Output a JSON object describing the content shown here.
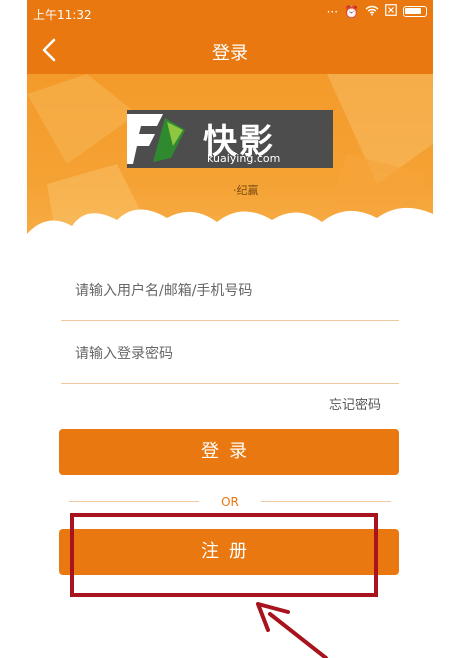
{
  "status_bar": {
    "time": "上午11:32",
    "icons": [
      "signal-dots-icon",
      "alarm-icon",
      "wifi-icon",
      "close-box-icon",
      "battery-icon"
    ]
  },
  "nav": {
    "title": "登录",
    "back_icon": "chevron-left-icon"
  },
  "banner": {
    "logo_text": "快影",
    "logo_url": "kuaiying.com",
    "signature": "·纪赢"
  },
  "form": {
    "username_placeholder": "请输入用户名/邮箱/手机号码",
    "password_placeholder": "请输入登录密码",
    "forgot_label": "忘记密码",
    "login_label": "登录",
    "or_label": "OR",
    "register_label": "注册"
  },
  "colors": {
    "accent": "#e8780f",
    "annotation": "#a8141e"
  }
}
